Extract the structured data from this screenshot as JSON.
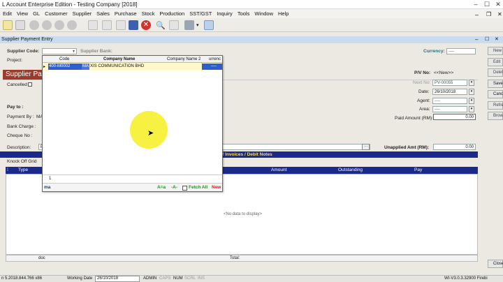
{
  "window": {
    "title": "L Account Enterprise Edition - Testing Company [2018]"
  },
  "menu": [
    "Edit",
    "View",
    "GL",
    "Customer",
    "Supplier",
    "Sales",
    "Purchase",
    "Stock",
    "Production",
    "SST/GST",
    "Inquiry",
    "Tools",
    "Window",
    "Help"
  ],
  "form": {
    "title": "Supplier Payment Entry",
    "supplier_code_label": "Supplier Code:",
    "supplier_bank_label": "Supplier Bank:",
    "currency_label": "Currency:",
    "currency_value": "----",
    "project_label": "Project:",
    "header_title": "Supplier Pa",
    "cancelled_label": "Cancelled",
    "pay_to_label": "Pay to :",
    "payment_by_label": "Payment By :",
    "payment_by_value": "MA",
    "bank_charge_label": "Bank Charge :",
    "cheque_no_label": "Cheque No :",
    "pv_no_label": "P/V No:",
    "pv_no_value": "<<New>>",
    "next_no_label": "Next No:",
    "next_no_value": "PV-00055",
    "date_label": "Date:",
    "date_value": "26/10/2018",
    "agent_label": "Agent:",
    "agent_value": "----",
    "area_label": "Area:",
    "area_value": "----",
    "paid_amount_label": "Paid Amount (RM):",
    "paid_amount_value": "0.00",
    "description_label": "Description:",
    "description_value": "P",
    "unapplied_label": "Unapplied Amt (RM):",
    "unapplied_value": "0.00",
    "knock_off_bar": "ff Invoices / Debit Notes",
    "knock_off_grid_label": "Knock Off Grid",
    "grid_columns": [
      "Type",
      "Amount",
      "Outstanding",
      "Pay"
    ],
    "no_data": "<No data to display>",
    "footer_doc": "doc",
    "footer_total": "Total:"
  },
  "right_buttons": [
    "New",
    "Edit",
    "Delete",
    "Save",
    "Cancel",
    "Refresh",
    "Browse",
    "Close"
  ],
  "lookup": {
    "columns": [
      "Code",
      "Company Name",
      "Company Name 2",
      "urrenc"
    ],
    "row": {
      "code": "400-M0002",
      "name_highlight": "MA",
      "name_rest": "XIS COMMUNICATION BHD",
      "currency": "----"
    },
    "count": "1",
    "search_text": "ma",
    "case_label": "A=a",
    "a_label": "-A-",
    "fetch_all_label": "Fetch All",
    "new_label": "New"
  },
  "status": {
    "version": "n 5.2018.844.766 x86",
    "working_date_label": "Working Date",
    "working_date": "26/10/2018",
    "user": "ADMIN",
    "caps": "CAPS",
    "num": "NUM",
    "scrl": "SCRL",
    "ins": "INS",
    "build": "WI-V3.0.3.32900 Firebi"
  }
}
